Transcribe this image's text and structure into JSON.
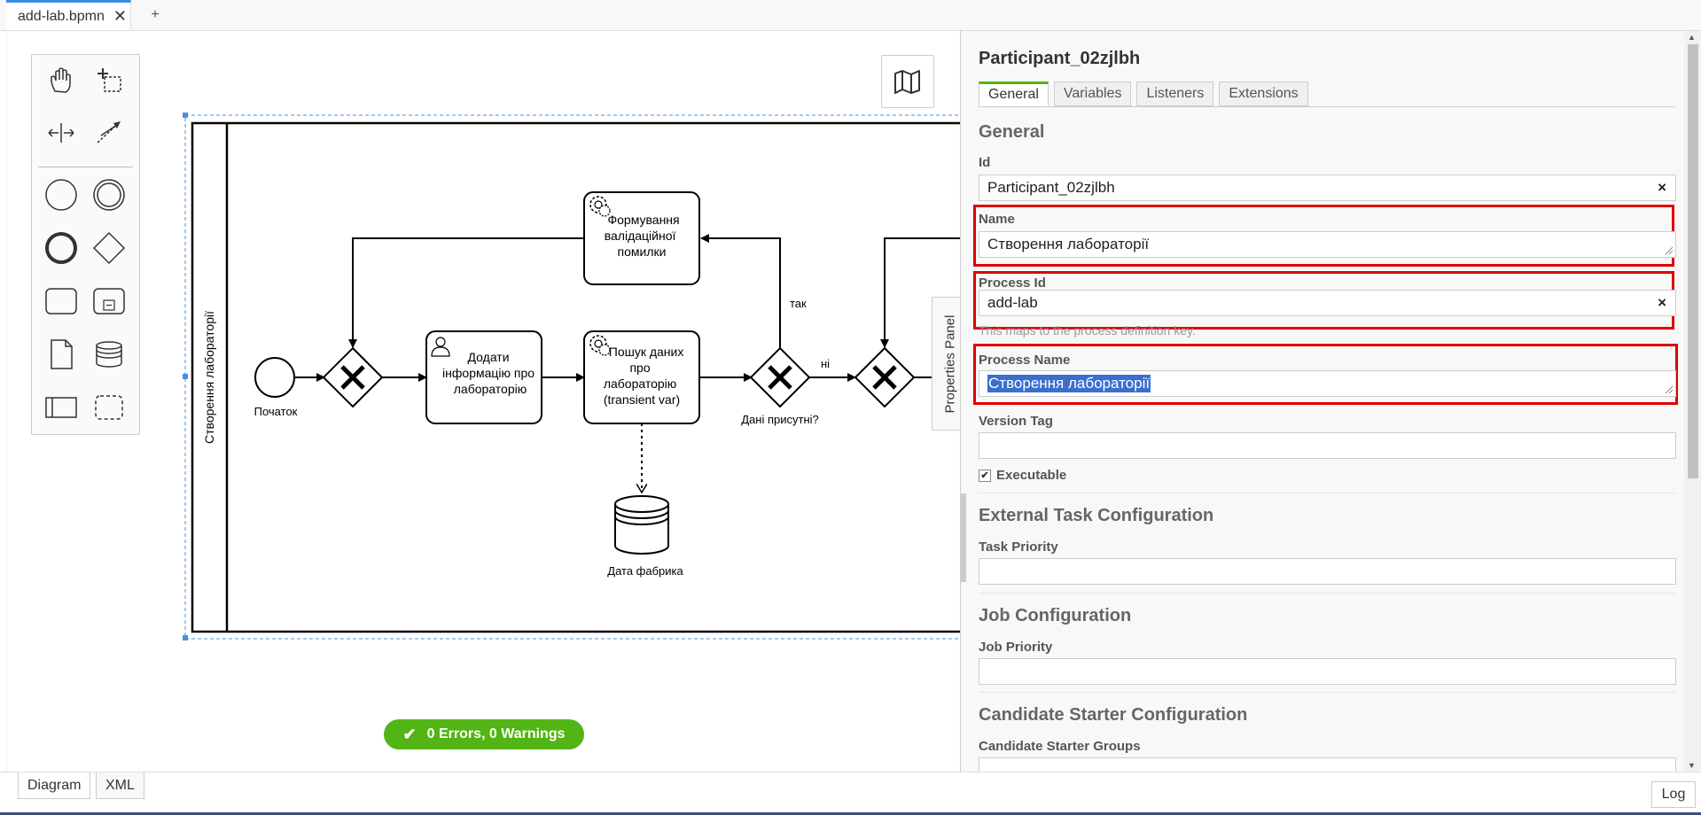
{
  "tabs": {
    "file_tab": "add-lab.bpmn",
    "close_glyph": "✕",
    "new_tab": "+"
  },
  "diagram": {
    "lane_label": "Створення лабораторії",
    "start_label": "Початок",
    "task_add": [
      "Додати",
      "інформацію про",
      "лабораторію"
    ],
    "task_search": [
      "Пошук даних",
      "про",
      "лабораторію",
      "(transient var)"
    ],
    "task_error": [
      "Формування",
      "валідаційної",
      "помилки"
    ],
    "gateway_label": "Дані присутні?",
    "flow_yes": "так",
    "flow_no": "ні",
    "datastore_label": "Дата фабрика"
  },
  "status": {
    "text": "0 Errors, 0 Warnings",
    "color": "#52b415"
  },
  "properties_toggle": "Properties Panel",
  "panel": {
    "title": "Participant_02zjlbh",
    "tabs": [
      "General",
      "Variables",
      "Listeners",
      "Extensions"
    ],
    "general_title": "General",
    "id_label": "Id",
    "id_value": "Participant_02zjlbh",
    "name_label": "Name",
    "name_value": "Створення лабораторії",
    "process_id_label": "Process Id",
    "process_id_value": "add-lab",
    "process_id_hint": "This maps to the process definition key.",
    "process_name_label": "Process Name",
    "process_name_value": "Створення лабораторії",
    "version_tag_label": "Version Tag",
    "version_tag_value": "",
    "executable_label": "Executable",
    "executable_checked": true,
    "external_title": "External Task Configuration",
    "task_priority_label": "Task Priority",
    "job_title": "Job Configuration",
    "job_priority_label": "Job Priority",
    "candidate_title": "Candidate Starter Configuration",
    "candidate_groups_label": "Candidate Starter Groups",
    "clear_glyph": "×",
    "highlight_color": "#e00000"
  },
  "bottom": {
    "diagram_tab": "Diagram",
    "xml_tab": "XML",
    "log_button": "Log"
  }
}
